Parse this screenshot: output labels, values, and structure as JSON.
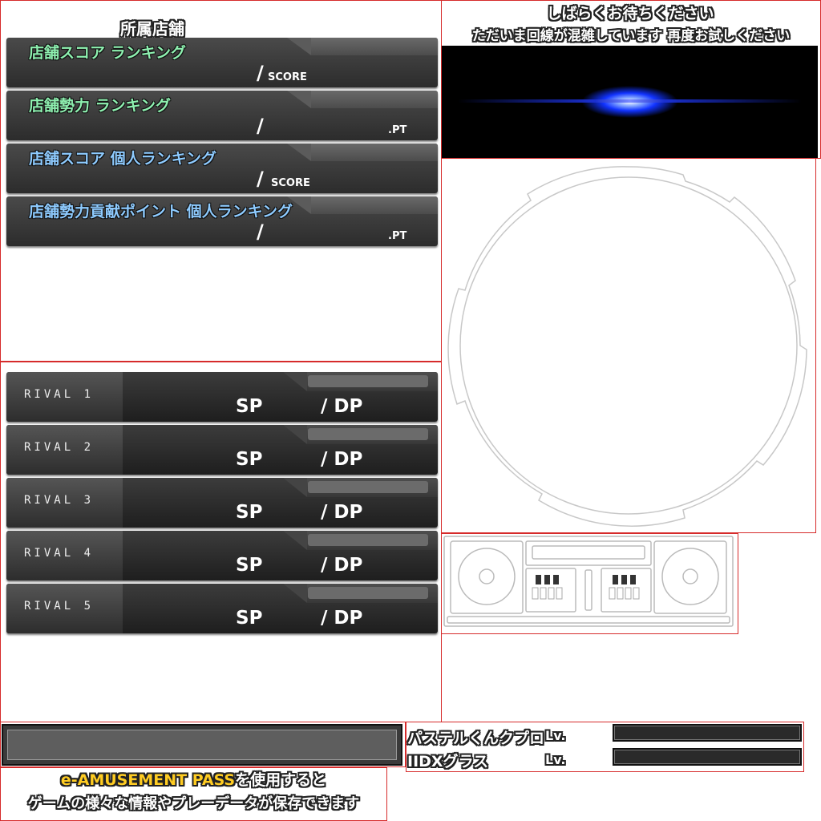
{
  "shop": {
    "header": "所属店舗",
    "panels": [
      {
        "label": "店舗スコア ランキング",
        "slash": "/",
        "unit": "SCORE",
        "color": "#8ef0b0"
      },
      {
        "label": "店舗勢力 ランキング",
        "slash": "/",
        "unit": ".PT",
        "color": "#8ef0b0"
      },
      {
        "label": "店舗スコア 個人ランキング",
        "slash": "/",
        "unit": "SCORE",
        "color": "#8ecbff"
      },
      {
        "label": "店舗勢力貢献ポイント 個人ランキング",
        "slash": "/",
        "unit": ".PT",
        "color": "#8ecbff"
      }
    ]
  },
  "rivals": [
    {
      "name": "RIVAL 1",
      "sp": "SP",
      "dp": "/ DP"
    },
    {
      "name": "RIVAL 2",
      "sp": "SP",
      "dp": "/ DP"
    },
    {
      "name": "RIVAL 3",
      "sp": "SP",
      "dp": "/ DP"
    },
    {
      "name": "RIVAL 4",
      "sp": "SP",
      "dp": "/ DP"
    },
    {
      "name": "RIVAL 5",
      "sp": "SP",
      "dp": "/ DP"
    }
  ],
  "status": {
    "line1": "しばらくお待ちください",
    "line2": "ただいま回線が混雑しています 再度お試しください"
  },
  "pass": {
    "brand": "e-AMUSEMENT PASS",
    "line1_suffix": "を使用すると",
    "line2": "ゲームの様々な情報やプレーデータが保存できます"
  },
  "items": [
    {
      "name": "パステルくんクプロ",
      "lv": "Lv."
    },
    {
      "name": "IIDXグラス",
      "lv": "Lv."
    }
  ],
  "colors": {
    "border": "#d62b2b",
    "green_label": "#8ef0b0",
    "blue_label": "#8ecbff",
    "pass_yellow": "#ffcc22"
  }
}
